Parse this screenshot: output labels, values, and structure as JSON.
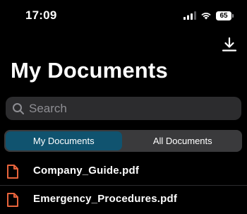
{
  "status_bar": {
    "time": "17:09",
    "battery_level": "65",
    "icons": [
      "cellular-signal-icon",
      "wifi-icon",
      "battery-icon"
    ]
  },
  "toolbar": {
    "download_icon": "download-icon"
  },
  "header": {
    "title": "My Documents"
  },
  "search": {
    "placeholder": "Search",
    "icon": "search-icon"
  },
  "segments": [
    {
      "label": "My Documents",
      "selected": true
    },
    {
      "label": "All Documents",
      "selected": false
    }
  ],
  "files": [
    {
      "name": "Company_Guide.pdf",
      "icon": "document-icon"
    },
    {
      "name": "Emergency_Procedures.pdf",
      "icon": "document-icon"
    }
  ],
  "colors": {
    "background": "#000000",
    "search_bg": "#2c2c2e",
    "segment_bg": "#3a3a3c",
    "segment_active": "#10536f",
    "file_icon": "#e8643c",
    "text": "#ffffff",
    "placeholder": "#8e8e93"
  }
}
